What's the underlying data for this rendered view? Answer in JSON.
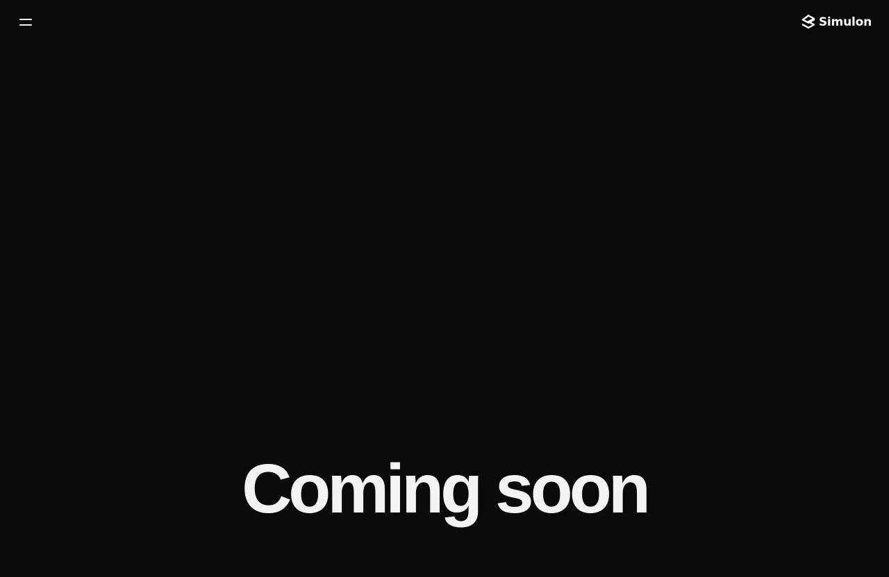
{
  "header": {
    "menu_icon": "hamburger-menu-icon",
    "brand": {
      "logo_icon": "simulon-logo-icon",
      "name": "Simulon"
    }
  },
  "main": {
    "headline": "Coming soon"
  },
  "colors": {
    "background": "#0a0a0a",
    "foreground": "#f3f3f3"
  }
}
